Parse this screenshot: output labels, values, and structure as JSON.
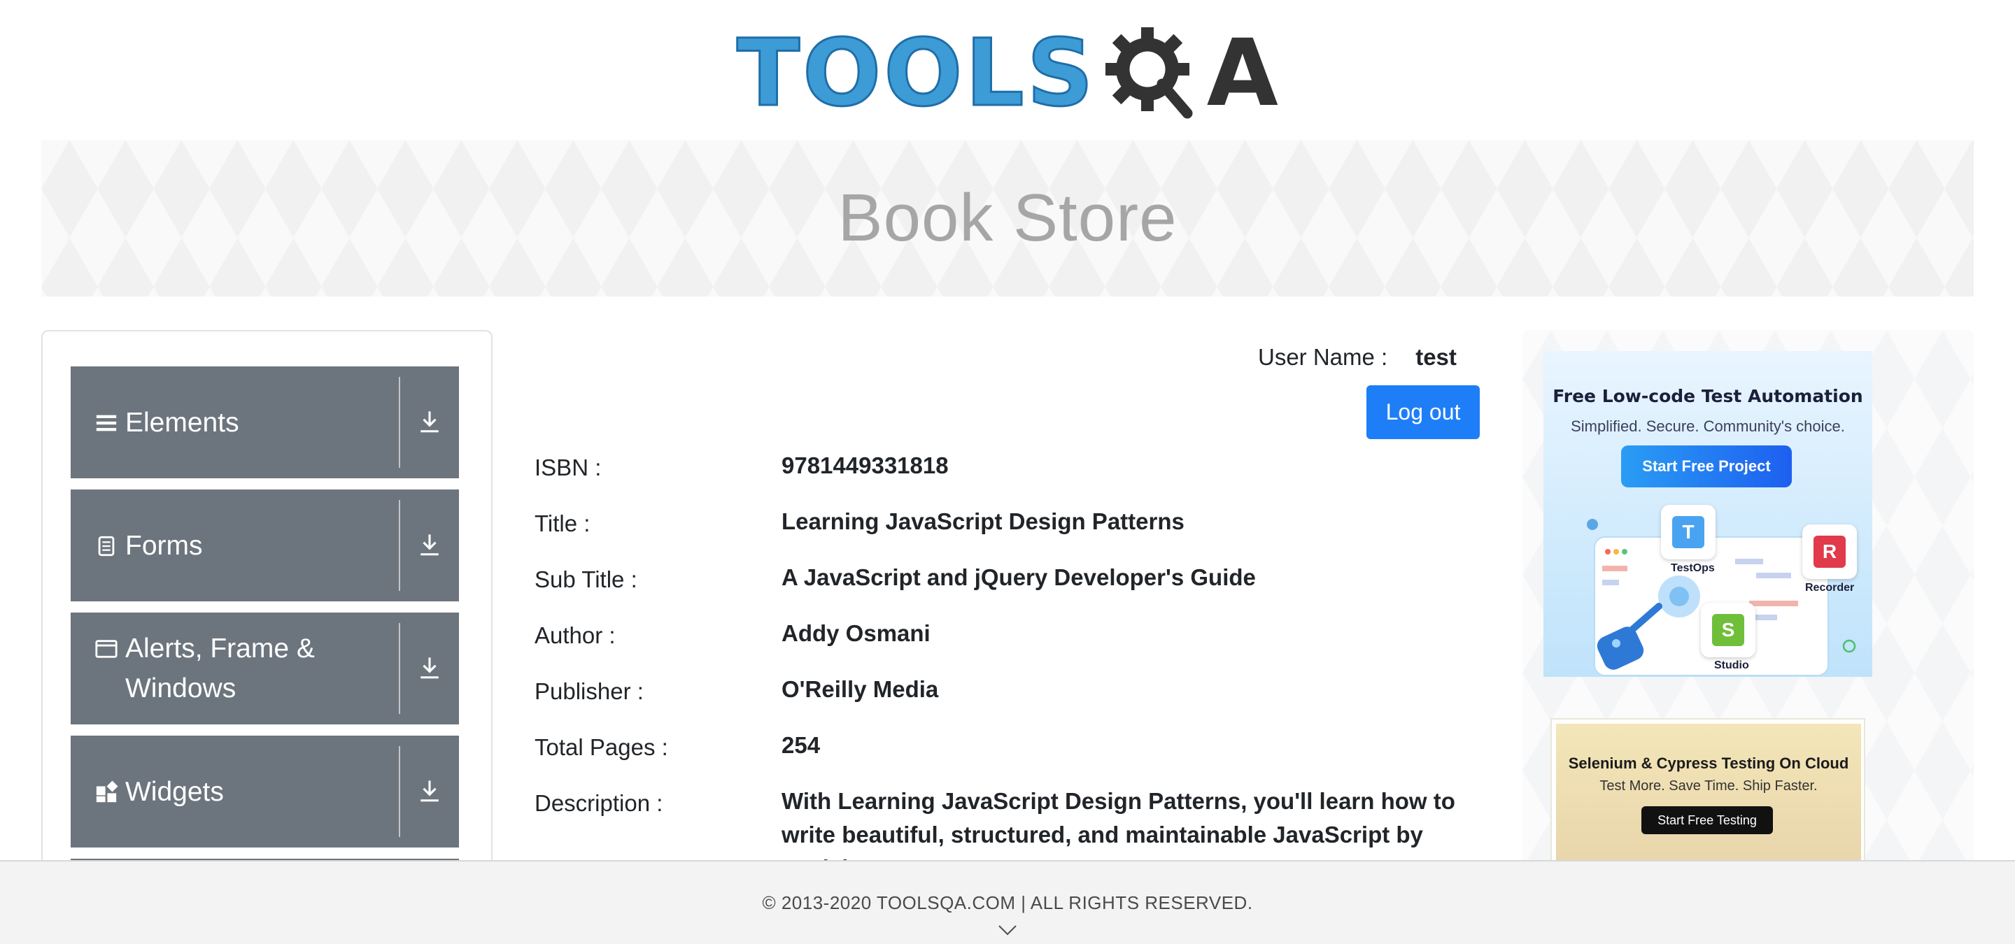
{
  "header": {
    "logo_text_left": "TOOLS",
    "logo_text_right": "A",
    "banner_title": "Book Store"
  },
  "sidebar": {
    "groups": [
      {
        "label": "Elements",
        "icon": "hamburger-icon"
      },
      {
        "label": "Forms",
        "icon": "document-icon"
      },
      {
        "label": "Alerts, Frame & Windows",
        "icon": "window-icon"
      },
      {
        "label": "Widgets",
        "icon": "widgets-icon"
      }
    ]
  },
  "user": {
    "label": "User Name :",
    "value": "test",
    "logout_label": "Log out"
  },
  "book": {
    "isbn": {
      "label": "ISBN :",
      "value": "9781449331818"
    },
    "title": {
      "label": "Title :",
      "value": "Learning JavaScript Design Patterns"
    },
    "subtitle": {
      "label": "Sub Title :",
      "value": "A JavaScript and jQuery Developer's Guide"
    },
    "author": {
      "label": "Author :",
      "value": "Addy Osmani"
    },
    "publisher": {
      "label": "Publisher :",
      "value": "O'Reilly Media"
    },
    "pages": {
      "label": "Total Pages :",
      "value": "254"
    },
    "description": {
      "label": "Description :",
      "value": "With Learning JavaScript Design Patterns, you'll learn how to write beautiful, structured, and maintainable JavaScript by applying"
    }
  },
  "ads": {
    "ad1": {
      "heading": "Free Low-code Test Automation",
      "sub": "Simplified. Secure. Community's choice.",
      "button": "Start Free Project",
      "tiles": [
        "TestOps",
        "Recorder",
        "Studio"
      ]
    },
    "ad2": {
      "heading": "Selenium & Cypress Testing On Cloud",
      "sub": "Test More. Save Time. Ship Faster.",
      "button": "Start Free Testing"
    }
  },
  "footer": {
    "copyright": "© 2013-2020 TOOLSQA.COM | ALL RIGHTS RESERVED."
  },
  "colors": {
    "group_bg": "#6c757d",
    "primary_button": "#1e7ef7",
    "logo_blue": "#3d9bd6"
  }
}
